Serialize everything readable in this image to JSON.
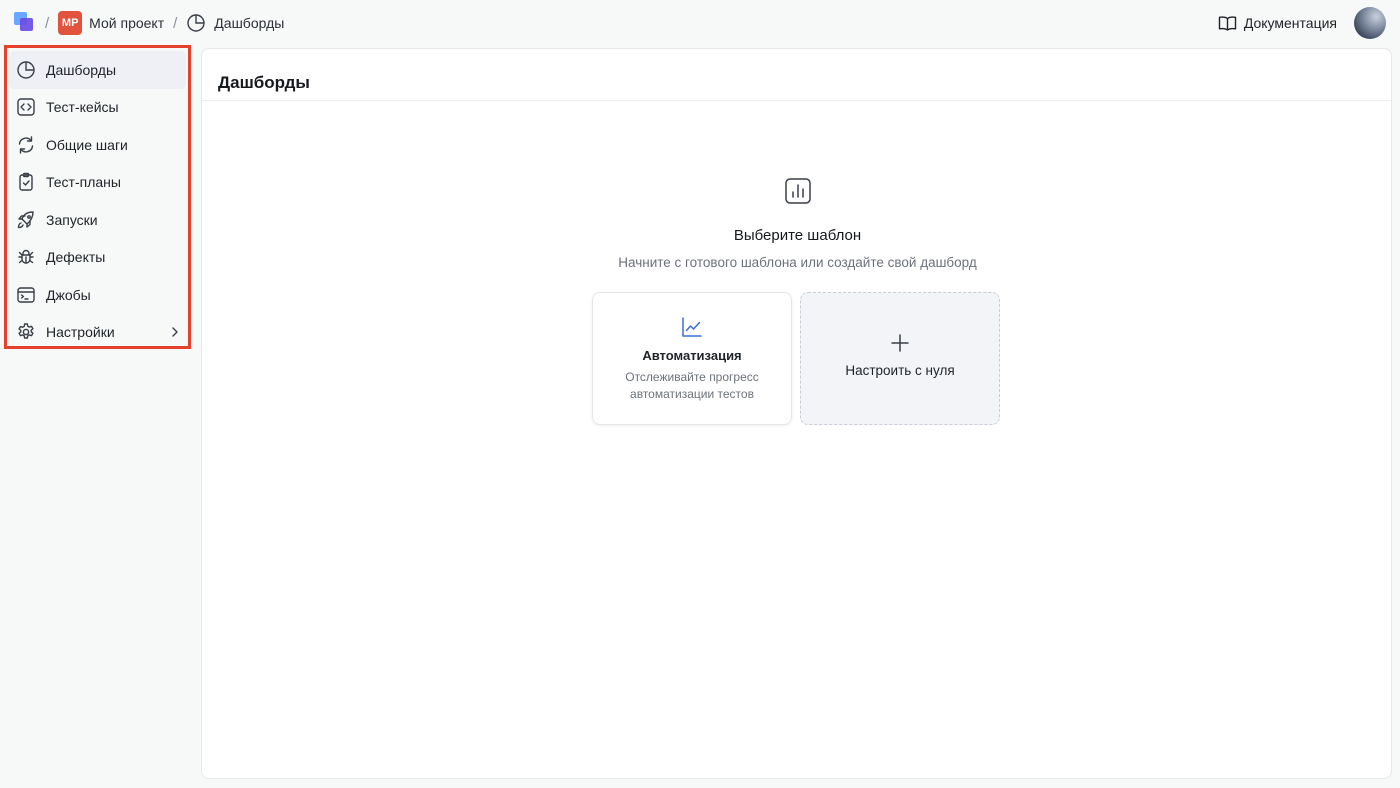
{
  "topbar": {
    "separator": "/",
    "project_badge": "MP",
    "project_name": "Мой проект",
    "current_page": "Дашборды",
    "docs_label": "Документация"
  },
  "sidebar": {
    "items": [
      {
        "label": "Дашборды",
        "icon": "pie-chart-icon",
        "active": true
      },
      {
        "label": "Тест-кейсы",
        "icon": "code-icon"
      },
      {
        "label": "Общие шаги",
        "icon": "refresh-icon"
      },
      {
        "label": "Тест-планы",
        "icon": "clipboard-check-icon"
      },
      {
        "label": "Запуски",
        "icon": "rocket-icon"
      },
      {
        "label": "Дефекты",
        "icon": "bug-icon"
      },
      {
        "label": "Джобы",
        "icon": "terminal-icon"
      },
      {
        "label": "Настройки",
        "icon": "gear-icon",
        "has_submenu": true
      }
    ]
  },
  "main": {
    "title": "Дашборды",
    "empty_title": "Выберите шаблон",
    "empty_subtitle": "Начните с готового шаблона или создайте свой дашборд",
    "cards": [
      {
        "title": "Автоматизация",
        "description": "Отслеживайте прогресс автоматизации тестов",
        "icon": "line-chart-icon"
      },
      {
        "title": "Настроить с нуля",
        "icon": "plus-icon"
      }
    ]
  },
  "colors": {
    "highlight_border": "#e5422e",
    "project_badge": "#e1533d",
    "accent_blue": "#3d6fd9"
  }
}
